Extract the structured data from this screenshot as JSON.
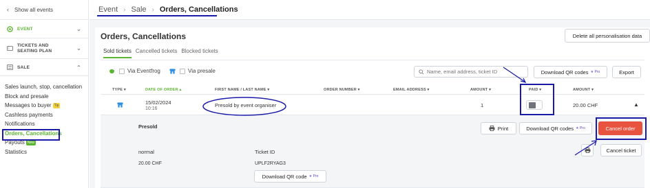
{
  "sidebar": {
    "back_label": "Show all events",
    "sections": [
      {
        "label": "EVENT",
        "active": true
      },
      {
        "label": "TICKETS AND SEATING PLAN",
        "active": false
      },
      {
        "label": "SALE",
        "active": false
      }
    ],
    "items": [
      {
        "label": "Sales launch, stop, cancellation"
      },
      {
        "label": "Block and presale"
      },
      {
        "label": "Messages to buyer",
        "tag": "Tip"
      },
      {
        "label": "Cashless payments"
      },
      {
        "label": "Notifications"
      },
      {
        "label": "Orders, Cancellations",
        "active": true
      },
      {
        "label": "Payouts",
        "tag": "New"
      },
      {
        "label": "Statistics"
      }
    ]
  },
  "breadcrumb": {
    "items": [
      "Event",
      "Sale",
      "Orders, Cancellations"
    ]
  },
  "page": {
    "title": "Orders, Cancellations",
    "delete_personalisation_label": "Delete all personalisation data"
  },
  "tabs": [
    {
      "label": "Sold tickets",
      "active": true
    },
    {
      "label": "Cancelled tickets",
      "active": false
    },
    {
      "label": "Blocked tickets",
      "active": false
    }
  ],
  "filters": {
    "via_eventfrog": "Via Eventfrog",
    "via_presale": "Via presale"
  },
  "search": {
    "placeholder": "Name, email address, ticket ID"
  },
  "toolbar": {
    "download_qr_label": "Download QR codes",
    "pro_label": "Pro",
    "export_label": "Export"
  },
  "table": {
    "columns": [
      "TYPE",
      "DATE OF ORDER",
      "FIRST NAME / LAST NAME",
      "ORDER NUMBER",
      "EMAIL ADDRESS",
      "AMOUNT",
      "PAID",
      "AMOUNT"
    ],
    "rows": [
      {
        "date": "15/02/2024",
        "time": "10:16",
        "name": "Presold by event organiser",
        "order_number": "",
        "email": "",
        "quantity": "1",
        "paid": false,
        "amount": "20.00 CHF"
      }
    ]
  },
  "detail": {
    "heading": "Presold",
    "print_label": "Print",
    "download_qr_label": "Download QR codes",
    "cancel_order_label": "Cancel order",
    "ticket": {
      "category": "normal",
      "price": "20.00 CHF",
      "id_label": "Ticket ID",
      "id_value": "UPLF2RYAG3",
      "download_qr_label": "Download QR code",
      "cancel_ticket_label": "Cancel ticket"
    }
  },
  "colors": {
    "accent": "#5cb531",
    "danger": "#e8533f",
    "annotation": "#1a1aa8",
    "pro": "#5b43c4"
  }
}
